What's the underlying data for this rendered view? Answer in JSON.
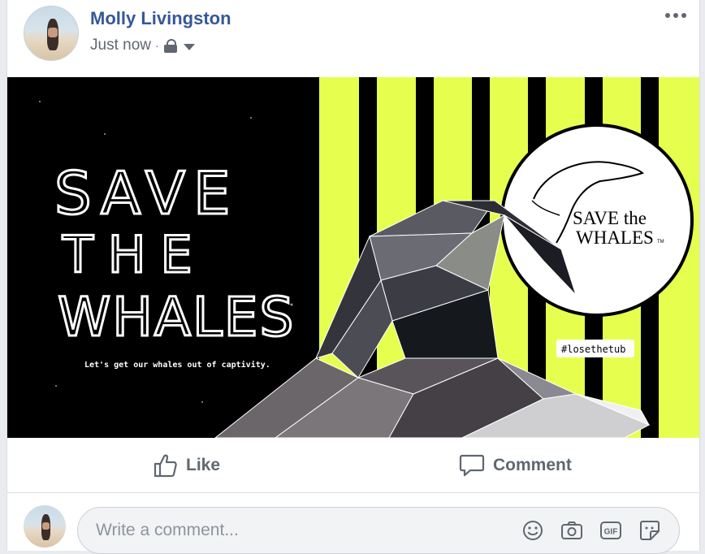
{
  "post": {
    "author": "Molly Livingston",
    "timestamp": "Just now",
    "separator": "·",
    "privacy_icon": "lock-icon",
    "audience_menu_icon": "caret-down-icon",
    "options_icon": "more-dots-icon"
  },
  "image": {
    "headline_lines": [
      "SAVE",
      "THE",
      "WHALES"
    ],
    "tagline": "Let's get our whales out of captivity.",
    "logo_line1": "SAVE the",
    "logo_line2": "WHALES",
    "logo_tm": "TM",
    "hashtag": "#losethetub",
    "colors": {
      "left_background": "#000000",
      "stripe_yellow": "#e6ff4f",
      "stripe_black": "#000000",
      "whale_grey": "#4a4a52"
    }
  },
  "actions": {
    "like_label": "Like",
    "like_icon": "thumbs-up-icon",
    "comment_label": "Comment",
    "comment_icon": "speech-bubble-icon"
  },
  "composer": {
    "placeholder": "Write a comment...",
    "tools": [
      "emoji-icon",
      "camera-icon",
      "gif-icon",
      "sticker-icon"
    ]
  },
  "colors": {
    "author_link": "#365899",
    "secondary_text": "#606770",
    "page_background": "#e9ebee"
  }
}
